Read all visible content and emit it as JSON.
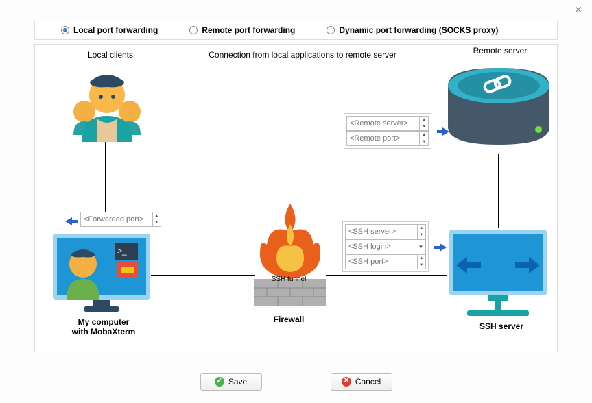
{
  "tabs": {
    "local": "Local port forwarding",
    "remote": "Remote port forwarding",
    "dynamic": "Dynamic port forwarding (SOCKS proxy)"
  },
  "heading": "Connection from local applications to remote server",
  "labels": {
    "local_clients": "Local clients",
    "remote_server": "Remote server",
    "my_computer_line1": "My computer",
    "my_computer_line2": "with MobaXterm",
    "ssh_tunnel": "SSH tunnel",
    "firewall": "Firewall",
    "ssh_server": "SSH server"
  },
  "inputs": {
    "forwarded_port": "<Forwarded port>",
    "remote_server": "<Remote server>",
    "remote_port": "<Remote port>",
    "ssh_server": "<SSH server>",
    "ssh_login": "<SSH login>",
    "ssh_port": "<SSH port>"
  },
  "buttons": {
    "save": "Save",
    "cancel": "Cancel"
  }
}
